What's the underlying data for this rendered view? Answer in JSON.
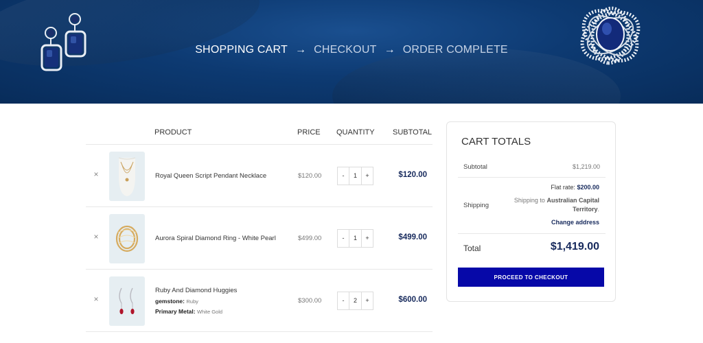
{
  "breadcrumb": {
    "steps": [
      "SHOPPING CART",
      "CHECKOUT",
      "ORDER COMPLETE"
    ],
    "separator": "→",
    "active_index": 0
  },
  "table": {
    "headers": {
      "product": "PRODUCT",
      "price": "PRICE",
      "quantity": "QUANTITY",
      "subtotal": "SUBTOTAL"
    },
    "remove_label": "×",
    "qty_minus": "-",
    "qty_plus": "+",
    "items": [
      {
        "name": "Royal Queen Script Pendant Necklace",
        "price": "$120.00",
        "quantity": "1",
        "subtotal": "$120.00",
        "image": "necklace-icon"
      },
      {
        "name": "Aurora Spiral Diamond Ring - White Pearl",
        "price": "$499.00",
        "quantity": "1",
        "subtotal": "$499.00",
        "image": "ring-icon"
      },
      {
        "name": "Ruby And Diamond Huggies",
        "price": "$300.00",
        "quantity": "2",
        "subtotal": "$600.00",
        "image": "earrings-icon",
        "meta": [
          {
            "label": "gemstone:",
            "value": "Ruby"
          },
          {
            "label": "Primary Metal:",
            "value": "White Gold"
          }
        ]
      }
    ]
  },
  "totals": {
    "title": "CART TOTALS",
    "subtotal_label": "Subtotal",
    "subtotal_value": "$1,219.00",
    "shipping_label": "Shipping",
    "flat_rate_label": "Flat rate:",
    "flat_rate_value": "$200.00",
    "shipping_to_prefix": "Shipping to",
    "shipping_to_place": "Australian Capital Territory",
    "shipping_to_suffix": ".",
    "change_address": "Change address",
    "total_label": "Total",
    "total_value": "$1,419.00",
    "checkout_button": "PROCEED TO CHECKOUT"
  },
  "colors": {
    "accent": "#0608a8",
    "price_text": "#16295c",
    "hero_background": "#0d3a72"
  }
}
